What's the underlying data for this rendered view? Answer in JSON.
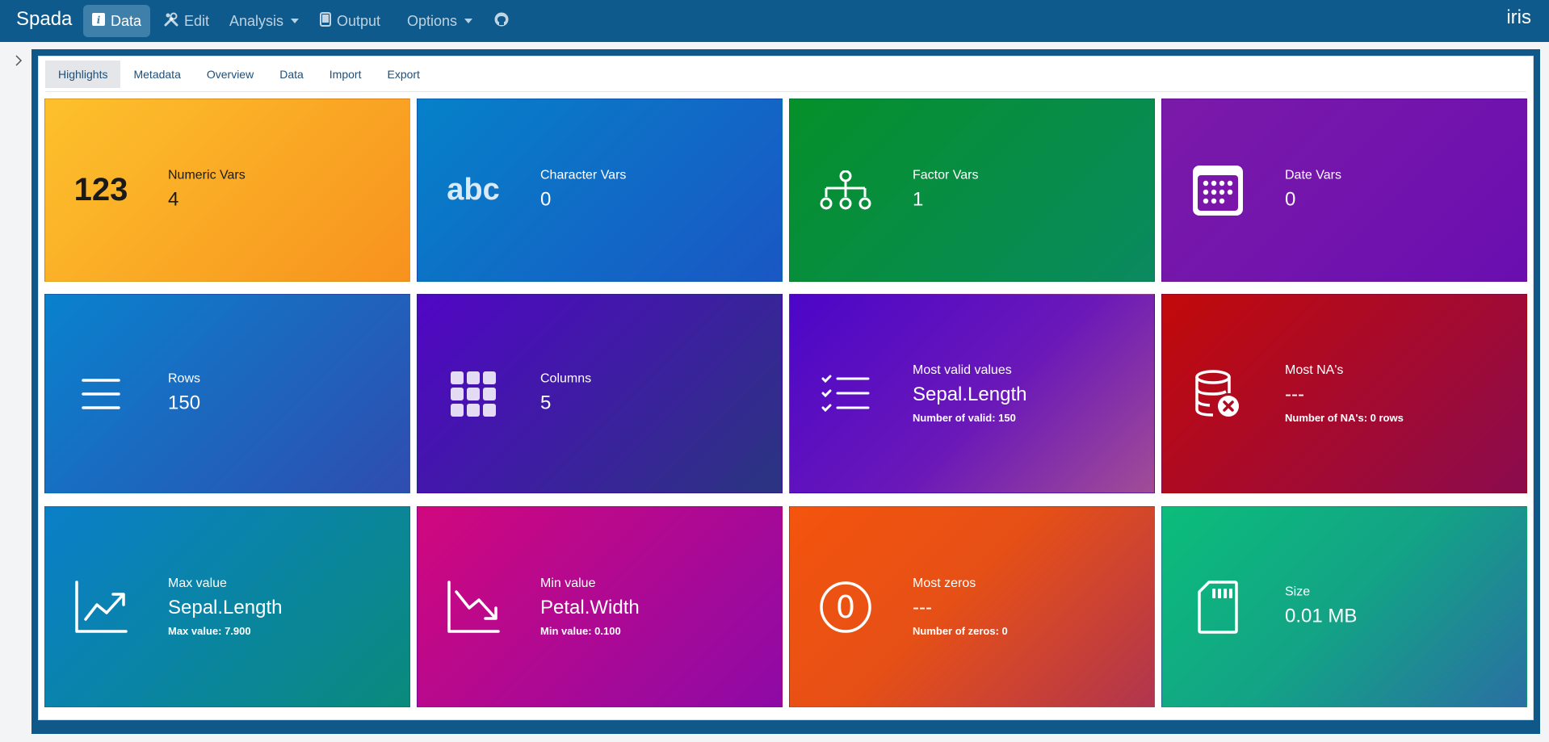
{
  "navbar": {
    "brand": "Spada",
    "items": [
      {
        "label": "Data",
        "icon": "info-icon"
      },
      {
        "label": "Edit",
        "icon": "tools-icon"
      },
      {
        "label": "Analysis",
        "icon": "caret-down-icon"
      },
      {
        "label": "Output",
        "icon": "tablet-icon"
      },
      {
        "label": "Options",
        "icon": "caret-down-icon"
      }
    ],
    "github_icon": "github-icon",
    "dataset_name": "iris"
  },
  "tabs": [
    "Highlights",
    "Metadata",
    "Overview",
    "Data",
    "Import",
    "Export"
  ],
  "cards": {
    "numeric": {
      "icon_text": "123",
      "label": "Numeric Vars",
      "value": "4",
      "color_from": "#fdc12c",
      "color_to": "#f7921e"
    },
    "character": {
      "icon_text": "abc",
      "label": "Character Vars",
      "value": "0",
      "color_from": "#0581c8",
      "color_to": "#1a57c4"
    },
    "factor": {
      "icon": "sitemap-icon",
      "label": "Factor Vars",
      "value": "1",
      "color_from": "#059029",
      "color_to": "#0a8a60"
    },
    "date": {
      "icon": "calendar-icon",
      "label": "Date Vars",
      "value": "0",
      "color_from": "#7b1aa9",
      "color_to": "#6a0eb0"
    },
    "rows": {
      "icon": "bars-icon",
      "label": "Rows",
      "value": "150",
      "color_from": "#0982cd",
      "color_to": "#2f4db0"
    },
    "columns": {
      "icon": "grid-icon",
      "label": "Columns",
      "value": "5",
      "color_from": "#5106c4",
      "color_to": "#2a3580"
    },
    "most_valid": {
      "icon": "checklist-icon",
      "label": "Most valid values",
      "value": "Sepal.Length",
      "sub": "Number of valid: 150",
      "color_from": "#4c06c8",
      "color_to": "#a24d96"
    },
    "most_na": {
      "icon": "database-x-icon",
      "label": "Most NA's",
      "value": "---",
      "sub": "Number of NA's: 0 rows",
      "color_from": "#c20a0a",
      "color_to": "#8b0b4e"
    },
    "max_value": {
      "icon": "chart-up-icon",
      "label": "Max value",
      "value": "Sepal.Length",
      "sub": "Max value: 7.900",
      "color_from": "#0a7fc9",
      "color_to": "#0a8a7c"
    },
    "min_value": {
      "icon": "chart-down-icon",
      "label": "Min value",
      "value": "Petal.Width",
      "sub": "Min value: 0.100",
      "color_from": "#d1087e",
      "color_to": "#8d0aa6"
    },
    "most_zeros": {
      "icon": "zero-circle-icon",
      "label": "Most zeros",
      "value": "---",
      "sub": "Number of zeros: 0",
      "color_from": "#f4540d",
      "color_to": "#b0354f"
    },
    "size": {
      "icon": "sd-card-icon",
      "label": "Size",
      "value": "0.01 MB",
      "color_from": "#0bbd7a",
      "color_to": "#2a6fa3"
    }
  }
}
